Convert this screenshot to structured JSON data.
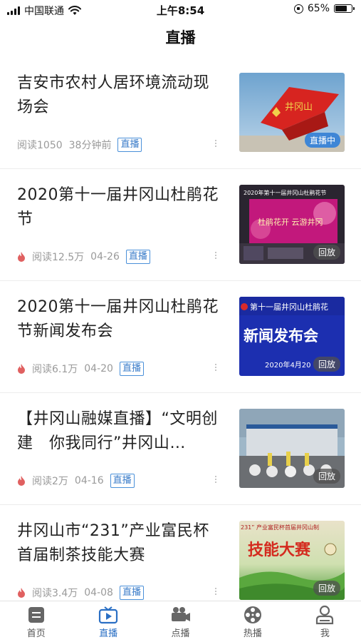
{
  "status_bar": {
    "carrier": "中国联通",
    "time": "上午8:54",
    "battery_percent": "65%",
    "battery_level": 0.65
  },
  "header": {
    "title": "直播"
  },
  "feed": [
    {
      "title": "吉安市农村人居环境流动现场会",
      "reads": "阅读1050",
      "time": "38分钟前",
      "tag": "直播",
      "hot": false,
      "badge": "直播中",
      "badge_style": "live",
      "thumb_text": "井冈山"
    },
    {
      "title": "2020第十一届井冈山杜鹃花节",
      "reads": "阅读12.5万",
      "time": "04-26",
      "tag": "直播",
      "hot": true,
      "badge": "回放",
      "badge_style": "replay",
      "thumb_text": "2020年第十一届井冈山杜鹃花节",
      "thumb_text2": "杜鹃花开 云游井冈"
    },
    {
      "title": "2020第十一届井冈山杜鹃花节新闻发布会",
      "reads": "阅读6.1万",
      "time": "04-20",
      "tag": "直播",
      "hot": true,
      "badge": "回放",
      "badge_style": "replay",
      "thumb_text": "第十一届井冈山杜鹃花",
      "thumb_text2": "新闻发布会",
      "thumb_text3": "2020年4月20"
    },
    {
      "title": "【井冈山融媒直播】“文明创建　你我同行”井冈山…",
      "reads": "阅读2万",
      "time": "04-16",
      "tag": "直播",
      "hot": true,
      "badge": "回放",
      "badge_style": "replay"
    },
    {
      "title": "井冈山市“231”产业富民杯首届制茶技能大赛",
      "reads": "阅读3.4万",
      "time": "04-08",
      "tag": "直播",
      "hot": true,
      "badge": "回放",
      "badge_style": "replay",
      "thumb_text": "231” 产业富民杯首届井冈山制",
      "thumb_text2": "技能大赛"
    }
  ],
  "tabs": [
    {
      "label": "首页",
      "icon": "home-icon",
      "active": false
    },
    {
      "label": "直播",
      "icon": "tv-icon",
      "active": true
    },
    {
      "label": "点播",
      "icon": "video-camera-icon",
      "active": false
    },
    {
      "label": "热播",
      "icon": "film-reel-icon",
      "active": false
    },
    {
      "label": "我",
      "icon": "user-icon",
      "active": false
    }
  ],
  "colors": {
    "accent": "#2a6fc4",
    "tab_inactive": "#555555",
    "tag_border": "#4a90d9",
    "hot_icon": "#e06060"
  }
}
